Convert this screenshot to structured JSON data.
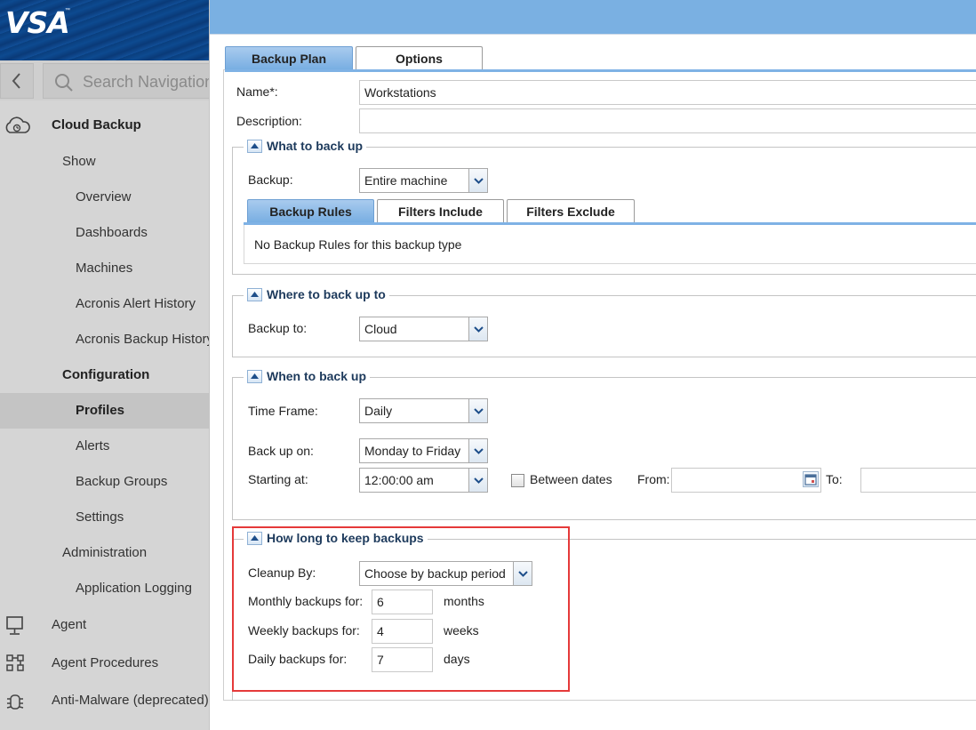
{
  "logo": {
    "text": "VSA",
    "tm": "™"
  },
  "search": {
    "placeholder": "Search Navigation"
  },
  "sidebar": {
    "items": [
      {
        "label": "Cloud Backup"
      },
      {
        "label": "Show"
      },
      {
        "label": "Overview"
      },
      {
        "label": "Dashboards"
      },
      {
        "label": "Machines"
      },
      {
        "label": "Acronis Alert History"
      },
      {
        "label": "Acronis Backup History"
      },
      {
        "label": "Configuration"
      },
      {
        "label": "Profiles"
      },
      {
        "label": "Alerts"
      },
      {
        "label": "Backup Groups"
      },
      {
        "label": "Settings"
      },
      {
        "label": "Administration"
      },
      {
        "label": "Application Logging"
      },
      {
        "label": "Agent"
      },
      {
        "label": "Agent Procedures"
      },
      {
        "label": "Anti-Malware (deprecated)"
      }
    ]
  },
  "tabs": {
    "backup_plan": "Backup Plan",
    "options": "Options"
  },
  "form": {
    "name_label": "Name*:",
    "name_value": "Workstations",
    "description_label": "Description:",
    "description_value": ""
  },
  "what": {
    "legend": "What to back up",
    "backup_label": "Backup:",
    "backup_value": "Entire machine",
    "subtabs": {
      "rules": "Backup Rules",
      "include": "Filters Include",
      "exclude": "Filters Exclude"
    },
    "no_rules_text": "No Backup Rules for this backup type"
  },
  "where": {
    "legend": "Where to back up to",
    "backup_to_label": "Backup to:",
    "backup_to_value": "Cloud"
  },
  "when": {
    "legend": "When to back up",
    "time_frame_label": "Time Frame:",
    "time_frame_value": "Daily",
    "back_up_on_label": "Back up on:",
    "back_up_on_value": "Monday to Friday",
    "starting_at_label": "Starting at:",
    "starting_at_value": "12:00:00 am",
    "between_dates_label": "Between dates",
    "between_dates_checked": false,
    "from_label": "From:",
    "from_value": "",
    "to_label": "To:",
    "to_value": ""
  },
  "keep": {
    "legend": "How long to keep backups",
    "cleanup_label": "Cleanup By:",
    "cleanup_value": "Choose by backup period",
    "monthly_label": "Monthly backups for:",
    "monthly_value": "6",
    "monthly_unit": "months",
    "weekly_label": "Weekly backups for:",
    "weekly_value": "4",
    "weekly_unit": "weeks",
    "daily_label": "Daily backups for:",
    "daily_value": "7",
    "daily_unit": "days"
  },
  "colors": {
    "topbar": "#7ab0e2",
    "highlight": "#e53a3a",
    "tab_active": "#78aee2"
  }
}
